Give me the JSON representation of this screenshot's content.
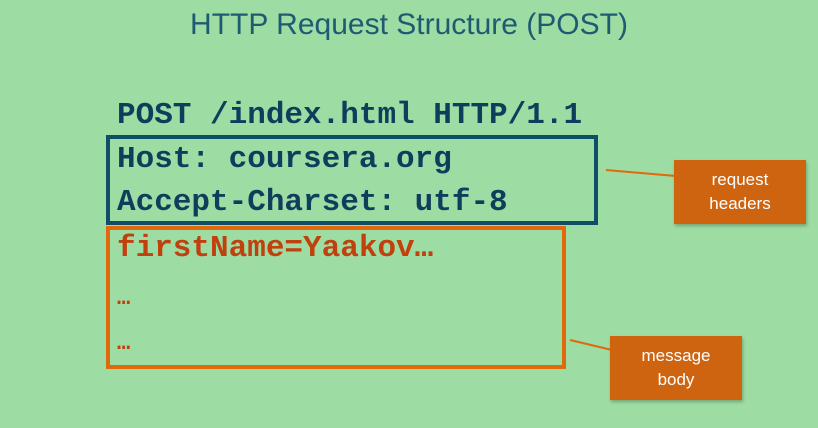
{
  "title": "HTTP Request Structure (POST)",
  "request_line": "POST /index.html HTTP/1.1",
  "headers": [
    "Host: coursera.org",
    "Accept-Charset: utf-8"
  ],
  "body_lines": [
    "firstName=Yaakov…",
    "…",
    "…"
  ],
  "callouts": {
    "headers": [
      "request",
      "headers"
    ],
    "body": [
      "message",
      "body"
    ]
  },
  "colors": {
    "background": "#9ddca2",
    "navy": "#0f3d5c",
    "orange": "#e0690c",
    "callout": "#cf6410"
  }
}
